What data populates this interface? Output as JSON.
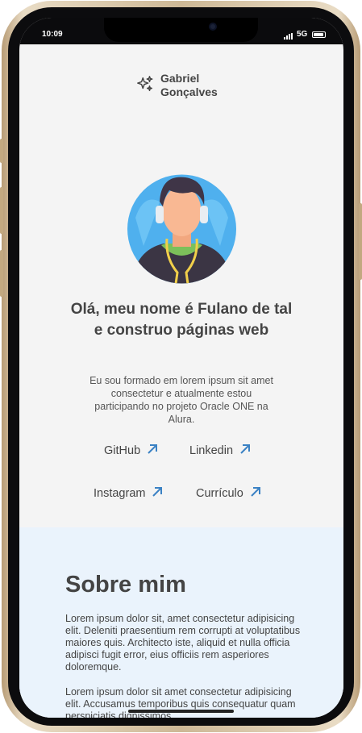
{
  "status": {
    "time": "10:09",
    "network": "5G"
  },
  "logo": {
    "name_line1": "Gabriel",
    "name_line2": "Gonçalves",
    "icon": "sparkles-icon"
  },
  "hero": {
    "title": "Olá, meu nome é Fulano de tal e construo páginas web",
    "description": "Eu sou formado em lorem ipsum sit amet consectetur e atualmente estou participando no projeto Oracle ONE na Alura."
  },
  "links": [
    {
      "label": "GitHub",
      "icon": "arrow-up-right-icon"
    },
    {
      "label": "Linkedin",
      "icon": "arrow-up-right-icon"
    },
    {
      "label": "Instagram",
      "icon": "arrow-up-right-icon"
    },
    {
      "label": "Currículo",
      "icon": "arrow-up-right-icon"
    }
  ],
  "about": {
    "title": "Sobre mim",
    "paragraph1": "Lorem ipsum dolor sit, amet consectetur adipisicing elit. Deleniti praesentium rem corrupti at voluptatibus maiores quis. Architecto iste, aliquid et nulla officia adipisci fugit error, eius officiis rem asperiores doloremque.",
    "paragraph2": "Lorem ipsum dolor sit amet consectetur adipisicing elit. Accusamus temporibus quis consequatur quam perspiciatis dignissimos"
  },
  "colors": {
    "accent": "#3b82c4",
    "text": "#444444",
    "about_bg": "#eaf3fc",
    "page_bg": "#f4f4f4"
  }
}
